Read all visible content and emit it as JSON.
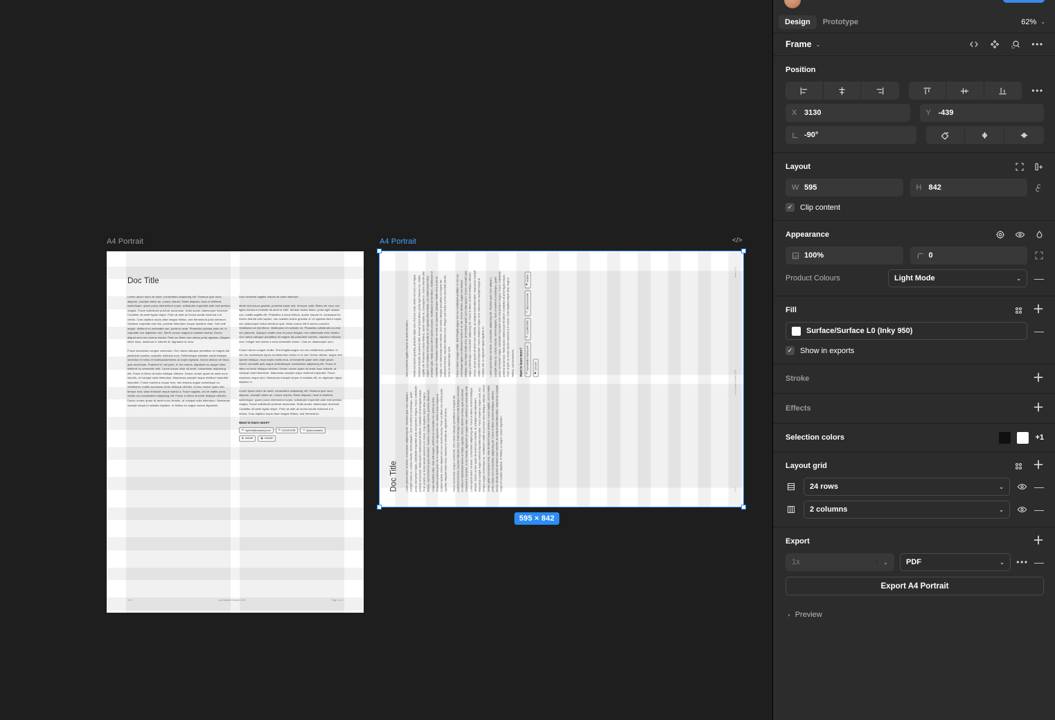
{
  "canvas": {
    "background": "#1e1e1e",
    "frames": [
      {
        "label": "A4 Portrait",
        "selected": false
      },
      {
        "label": "A4 Portrait",
        "selected": true
      }
    ],
    "selection_size_badge": "595 × 842",
    "code_badge": "</>"
  },
  "document": {
    "title": "Doc Title",
    "left_column": [
      "Lorem ipsum dolor sit amet, consectetur adipiscing elit. Vivamus quis nunc aliquam, suscipit metus ac, cursus mauris. Morbi aliquam, risus et eleifend scelerisque, quam purus elementum turpis, sollicitudin imperdiet ante erat pretium magna. Fusce sollicitudin pulvinar accumsan. Nulla auctor ullamcorper tincidunt. Curabitur sit amet ligula neque. Proin at ante ac lectus iaculis euismod a in metus. Cras dapibus turpis vitae magna finibus, sed fermentum justo interdum. Vivamus vulputate erat nisl, pulvinar bibendum neque faucibus vitae. Sed velit augue, eleifend eu venenatis non, porta eu ante. Phasellus pulvinar justo mi, in vulputate orci dignissim nec. Morbi cursus magna ut sodales lacinia. Donec aliquet sem nec viverra viverra. Proin eu libero nec metus porta egestas. Aliquam tellus risus, maximus in lobortis at, dignissim id urna.",
      "Fusce accumsan congue commodo. Orci varius natoque penatibus et magnis dis parturient montes, nascetur ridiculus mus. Pellentesque habitant morbi tristique senectus et netus et malesuada fames ac turpis egestas. Donec dictum vel risus quis accumsan. Praesent in nisi justo. In leo mauris, dignissim ac augue vitae, eleifend eu venenatis velit. Lorem ipsum dolor sit amet, consectetur adipiscing elit. Fusce in libero at tortor tristique ultricies. Donec ornare quam sit amet nunc lobortis, at volutpat nulla bibendum. Maecenas suscipit neque eleifend imperdiet imperdiet. Fusce maximus neque sem, nec tempus augue scelerisque eu. Vestibulum mattis accumsan tortor tristique ultricies. Donec ornare quam sed tempor erat, vitae tincidunt neque lacinia a. Fusce sagittis, orci et mattis porta, metus orci consectetur adipiscing elit. Fusce in libero at tortor tristique ultricies. Donec ornare quam sit amet nunc lobortis, at volutpat nulla bibendum. Maecenas suscipit neque id sodales dapibus. In finibus eu augue cursus dignissim."
    ],
    "right_column": [
      "Duis hendrerit sagittis mauris sit amet interdum.",
      "Morbi sed ipsum gravida, pharetra turpis sed, rhoncus nulla. Etiam vel nunc non ligula tincidunt molestie sit amet id nibh. Aenean lectus libero, porta eget massa non, mattis sagittis elit. Phasellus a lacus finibus, auctor mauris et, consequat ex. Donec blandit odio sapien, non sodales lectus gravida ut. Ut egestas libero turpis, nec ullamcorper tellus interdum quis. Nulla cursus elit id auctor posuere. Vestibulum at nisl libero. Vestibulum et molestie mi. Phasellus sollicitudin eu erat nec placerat. Quisque mattis urna et purus feugiat, non malesuada enim dictum. Orci varius natoque penatibus et magnis dis parturient montes, nascetur ridiculus mus. Integer sed metus a urna venenatis rutrum. Cras eu ullamcorper sem.",
      "Fusce rutrum congue mollis. Sed fringilla augue non leo vestibulum porttitor. In nec leo scelerisque ligula condimentum luctus in et nisl. Donec dictum, augue sed laoreet tristique, risus turpis mollis eros, at hendrerit quam sem vitae ipsum. Donec convallis quis augue pellentesque consectetur adipiscing elit. Fusce in libero at tortor tristique ultricies. Donec ornare quam sit amet nunc lobortis, at volutpat nulla bibendum. Maecenas suscipit neque eleifend imperdiet. Fusce maximus neque sem. Maecenas suscipit neque id sodales elit, eu dignissim ligula dapibus in.",
      "Lorem ipsum dolor sit amet, consectetur adipiscing elit. Vivamus quis nunc aliquam, suscipit metus ac, cursus mauris. Morbi aliquam, risus et eleifend scelerisque, quam purus elementum turpis, sollicitudin imperdiet ante erat pretium magna. Fusce sollicitudin pulvinar accumsan. Nulla auctor ullamcorper tincidunt. Curabitur sit amet ligula neque. Proin at ante ac lectus iaculis euismod a in metus. Cras dapibus turpis vitae magna finibus, sed fermentum."
    ],
    "learn_more_heading": "Want to learn more?",
    "contacts": [
      {
        "icon": "mail-icon",
        "glyph": "✉",
        "label": "myemail@company.com"
      },
      {
        "icon": "phone-icon",
        "glyph": "✆",
        "label": "012345 6789"
      },
      {
        "icon": "x-icon",
        "glyph": "✕",
        "label": "@accountname"
      },
      {
        "icon": "globe-icon",
        "glyph": "✹",
        "label": "website"
      },
      {
        "icon": "linkedin-icon",
        "glyph": "▣",
        "label": "LinkedIn"
      }
    ],
    "footer": {
      "version": "V1.0",
      "updated": "Last Updated October 2024",
      "page": "Page 1 of 1"
    }
  },
  "panel": {
    "tabs": [
      {
        "label": "Design",
        "active": true
      },
      {
        "label": "Prototype",
        "active": false
      }
    ],
    "zoom": "62%",
    "object": {
      "type": "Frame",
      "actions": [
        "code-icon",
        "component-icon",
        "dev-inspect-icon",
        "more-icon"
      ]
    },
    "position": {
      "title": "Position",
      "align_horizontal": [
        "align-left-icon",
        "align-horizontal-center-icon",
        "align-right-icon"
      ],
      "align_vertical": [
        "align-top-icon",
        "align-vertical-center-icon",
        "align-bottom-icon"
      ],
      "x_label": "X",
      "x_value": "3130",
      "y_label": "Y",
      "y_value": "-439",
      "rotation_value": "-90°",
      "transform_actions": [
        "corner-radius-icon",
        "flip-horizontal-icon",
        "flip-vertical-icon"
      ]
    },
    "layout": {
      "title": "Layout",
      "w_label": "W",
      "w_value": "595",
      "h_label": "H",
      "h_value": "842",
      "constrain_icon": "constrain-proportions-icon",
      "clip_content_label": "Clip content",
      "clip_content_checked": true,
      "actions": [
        "resize-to-fit-icon",
        "add-auto-layout-icon"
      ]
    },
    "appearance": {
      "title": "Appearance",
      "opacity_value": "100%",
      "corner_radius_value": "0",
      "product_colours_label": "Product Colours",
      "product_colours_value": "Light Mode",
      "actions": [
        "blend-mode-icon",
        "visibility-icon",
        "color-picker-icon"
      ],
      "independent_corners_icon": "independent-corners-icon"
    },
    "fill": {
      "title": "Fill",
      "style_name": "Surface/Surface L0 (Inky 950)",
      "swatch_color": "#ffffff",
      "show_in_exports_label": "Show in exports",
      "show_in_exports_checked": true
    },
    "stroke": {
      "title": "Stroke"
    },
    "effects": {
      "title": "Effects"
    },
    "selection_colors": {
      "title": "Selection colors",
      "swatches": [
        "#101010",
        "#ffffff"
      ],
      "more": "+1"
    },
    "layout_grid": {
      "title": "Layout grid",
      "rows": [
        {
          "icon": "rows-icon",
          "value": "24 rows"
        },
        {
          "icon": "columns-icon",
          "value": "2 columns"
        }
      ]
    },
    "export": {
      "title": "Export",
      "scale_value": "1x",
      "format_value": "PDF",
      "button_label": "Export A4 Portrait",
      "preview_label": "Preview"
    }
  }
}
